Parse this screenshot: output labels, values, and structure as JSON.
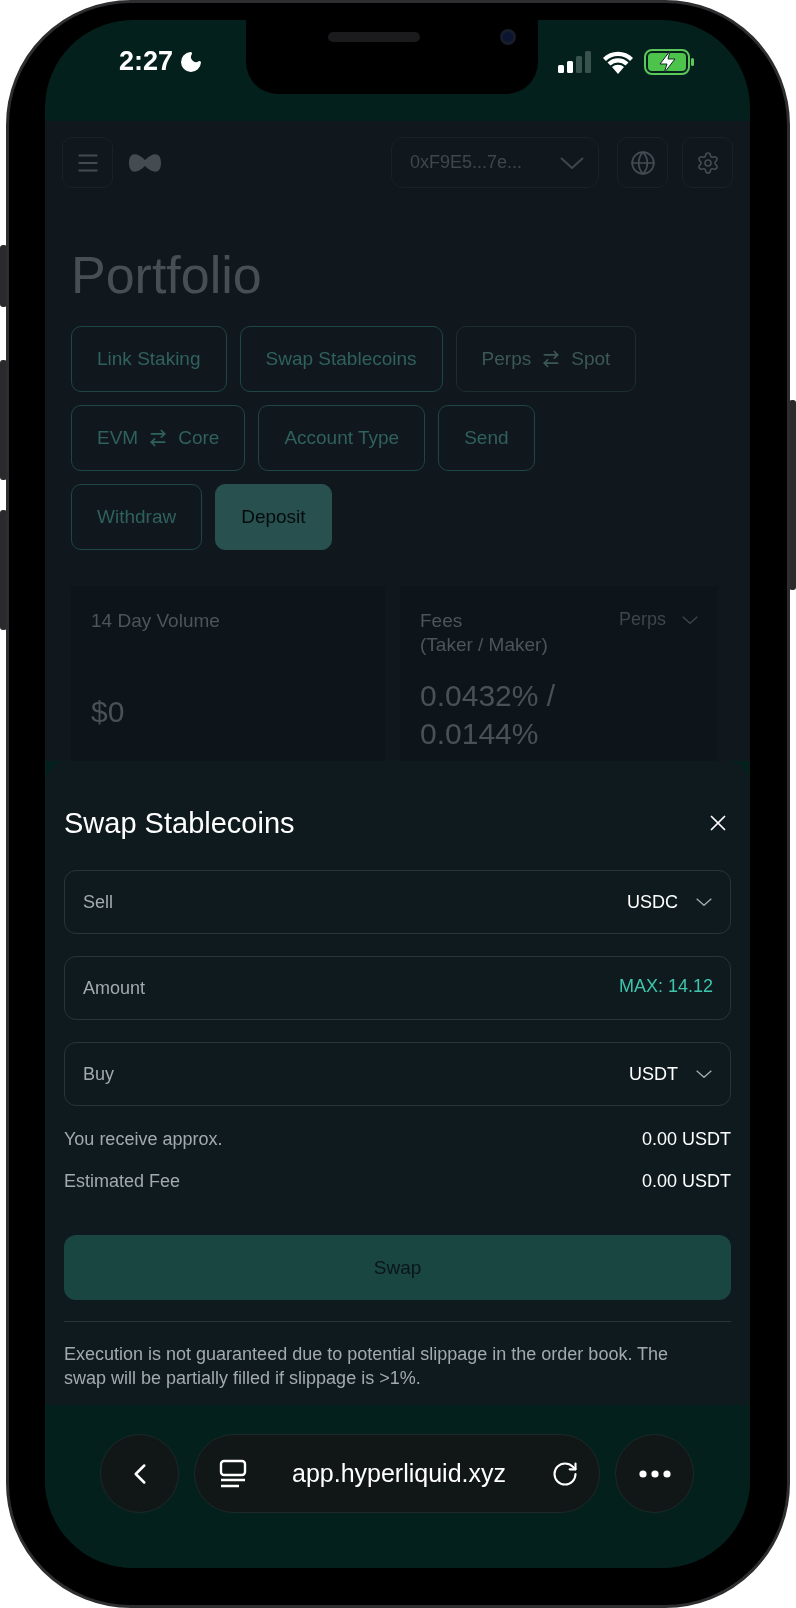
{
  "status_bar": {
    "time": "2:27"
  },
  "header": {
    "wallet": "0xF9E5...7e..."
  },
  "portfolio": {
    "title": "Portfolio",
    "action_rows": [
      [
        {
          "kind": "outline",
          "label": "Link Staking",
          "disabled": false
        },
        {
          "kind": "outline",
          "label": "Swap Stablecoins",
          "disabled": false
        },
        {
          "kind": "transfer",
          "left": "Perps",
          "right": "Spot",
          "disabled": true
        }
      ],
      [
        {
          "kind": "transfer",
          "left": "EVM",
          "right": "Core",
          "disabled": false
        },
        {
          "kind": "outline",
          "label": "Account Type",
          "disabled": false
        },
        {
          "kind": "outline",
          "label": "Send",
          "disabled": false
        }
      ],
      [
        {
          "kind": "outline",
          "label": "Withdraw",
          "disabled": false
        },
        {
          "kind": "filled",
          "label": "Deposit",
          "disabled": false
        }
      ]
    ],
    "stats": [
      {
        "label": "14 Day Volume",
        "value_lines": [
          "$0"
        ]
      },
      {
        "label": "Fees",
        "sublabel": "(Taker / Maker)",
        "selector": "Perps",
        "value_lines": [
          "0.0432% /",
          "0.0144%"
        ]
      }
    ]
  },
  "modal": {
    "title": "Swap Stablecoins",
    "fields": [
      {
        "kind": "select",
        "label": "Sell",
        "value": "USDC"
      },
      {
        "kind": "input",
        "placeholder": "Amount",
        "max": "MAX: 14.12"
      },
      {
        "kind": "select",
        "label": "Buy",
        "value": "USDT"
      }
    ],
    "summary": [
      {
        "label": "You receive approx.",
        "value": "0.00 USDT"
      },
      {
        "label": "Estimated Fee",
        "value": "0.00 USDT"
      }
    ],
    "button": "Swap",
    "note": "Execution is not guaranteed due to potential slippage in the order book. The swap will be partially filled if slippage is >1%."
  },
  "browser": {
    "url": "app.hyperliquid.xyz"
  }
}
